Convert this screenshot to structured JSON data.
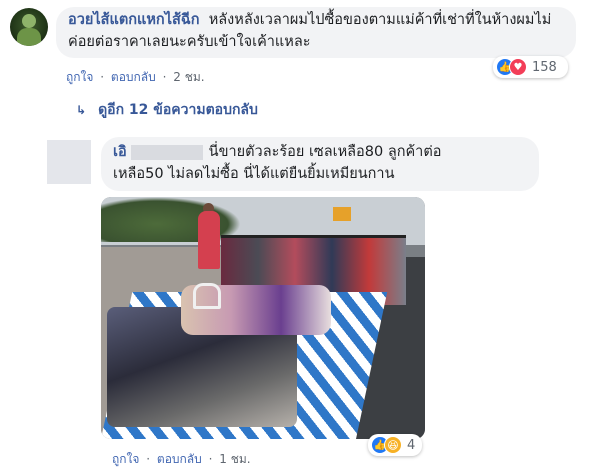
{
  "top_comment": {
    "author": "อวยไส้แตกแหกไส้ฉีก",
    "text": "หลังหลังเวลาผมไปซื้อของตามแม่ค้าที่เช่าที่ในห้างผมไม่ค่อยต่อราคาเลยนะครับเข้าใจเค้าแหละ",
    "like_label": "ถูกใจ",
    "reply_label": "ตอบกลับ",
    "time": "2 ชม.",
    "reaction_count": "158",
    "reactions": [
      "like-icon",
      "love-icon"
    ]
  },
  "more_replies": {
    "label": "ดูอีก 12 ข้อความตอบกลับ"
  },
  "reply_comment": {
    "author_prefix": "เอิ",
    "text_line1": "นี่ขายตัวละร้อย เซลเหลือ80 ลูกค้าต่อ",
    "text_line2": "เหลือ50 ไม่ลดไม่ซื้อ นี่ได้แต่ยืนยิ้มเหมียนกาน",
    "like_label": "ถูกใจ",
    "reply_label": "ตอบกลับ",
    "time": "1 ชม.",
    "reaction_count": "4",
    "reactions": [
      "like-icon",
      "haha-icon"
    ]
  },
  "colors": {
    "link": "#385898",
    "bubble": "#f2f3f5",
    "like": "#2078f4",
    "love": "#f33e58",
    "haha": "#f7b125"
  }
}
